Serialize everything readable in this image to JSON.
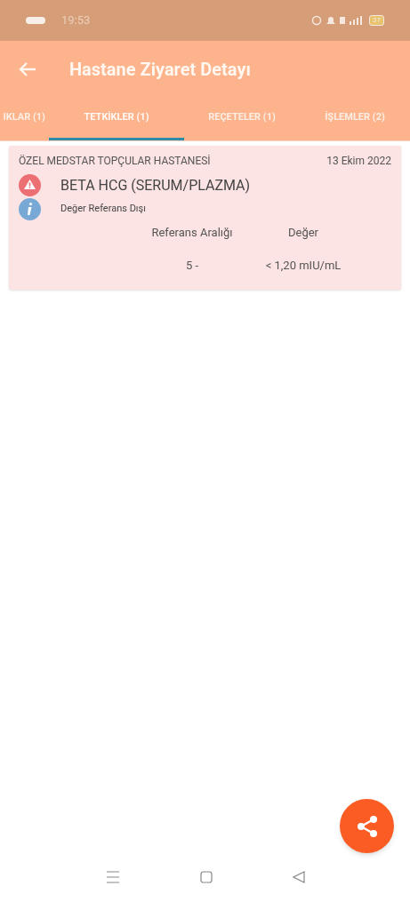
{
  "status_bar": {
    "time": "19:53",
    "battery": "37"
  },
  "app_bar": {
    "title": "Hastane Ziyaret Detayı"
  },
  "tabs": [
    {
      "label": "IKLAR (1)",
      "selected": false
    },
    {
      "label": "TETKİKLER (1)",
      "selected": true
    },
    {
      "label": "REÇETELER (1)",
      "selected": false
    },
    {
      "label": "İŞLEMLER (2)",
      "selected": false
    }
  ],
  "results": [
    {
      "hospital": "ÖZEL MEDSTAR TOPÇULAR HASTANESİ",
      "date": "13 Ekim 2022",
      "test": "BETA HCG (SERUM/PLAZMA)",
      "note": "Değer Referans Dışı",
      "out_of_range": true,
      "columns": [
        "Referans Aralığı",
        "Değer"
      ],
      "reference": "5 -",
      "value": "< 1,20 mIU/mL"
    }
  ]
}
